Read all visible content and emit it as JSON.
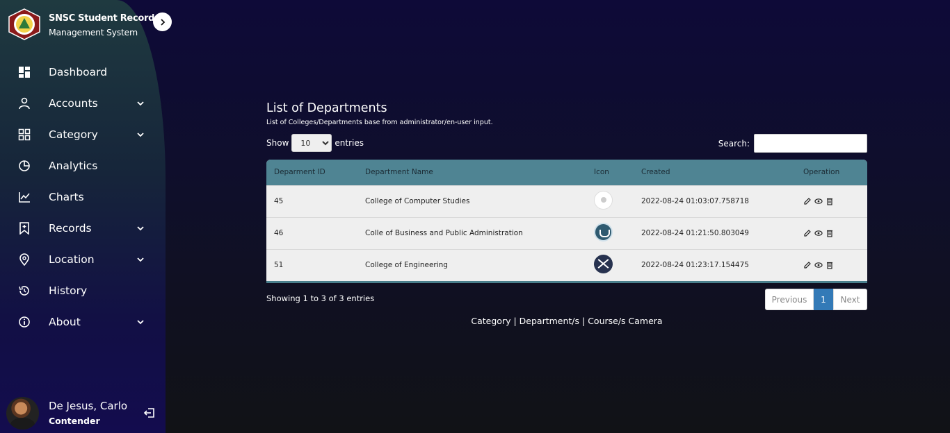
{
  "sidebar": {
    "brand_line1": "SNSC Student Record",
    "brand_line2": "Management System",
    "items": [
      {
        "label": "Dashboard"
      },
      {
        "label": "Accounts"
      },
      {
        "label": "Category"
      },
      {
        "label": "Analytics"
      },
      {
        "label": "Charts"
      },
      {
        "label": "Records"
      },
      {
        "label": "Location"
      },
      {
        "label": "History"
      },
      {
        "label": "About"
      }
    ],
    "user": {
      "name": "De Jesus, Carlo",
      "role": "Contender"
    }
  },
  "main": {
    "title": "List of Departments",
    "subtitle": "List of Colleges/Departments base from administrator/en-user input.",
    "show_label": "Show",
    "entries_value": "10",
    "entries_label": "entries",
    "search_label": "Search:",
    "search_value": "",
    "columns": [
      "Deparment ID",
      "Department Name",
      "Icon",
      "Created",
      "Operation"
    ],
    "rows": [
      {
        "id": "45",
        "name": "College of Computer Studies",
        "icon": "ccs-logo-icon",
        "created": "2022-08-24 01:03:07.758718"
      },
      {
        "id": "46",
        "name": "Colle of Business and Public Administration",
        "icon": "cbpa-logo-icon",
        "created": "2022-08-24 01:21:50.803049"
      },
      {
        "id": "51",
        "name": "College of Engineering",
        "icon": "coe-logo-icon",
        "created": "2022-08-24 01:23:17.154475"
      }
    ],
    "info": "Showing 1 to 3 of 3 entries",
    "pager": {
      "prev": "Previous",
      "page": "1",
      "next": "Next"
    },
    "footer_links": {
      "category": "Category",
      "sep1": " | ",
      "department": "Department/s",
      "sep2": " | ",
      "course": "Course/s Camera"
    }
  },
  "colors": {
    "accent": "#4f8493",
    "page_active": "#337ab7"
  }
}
